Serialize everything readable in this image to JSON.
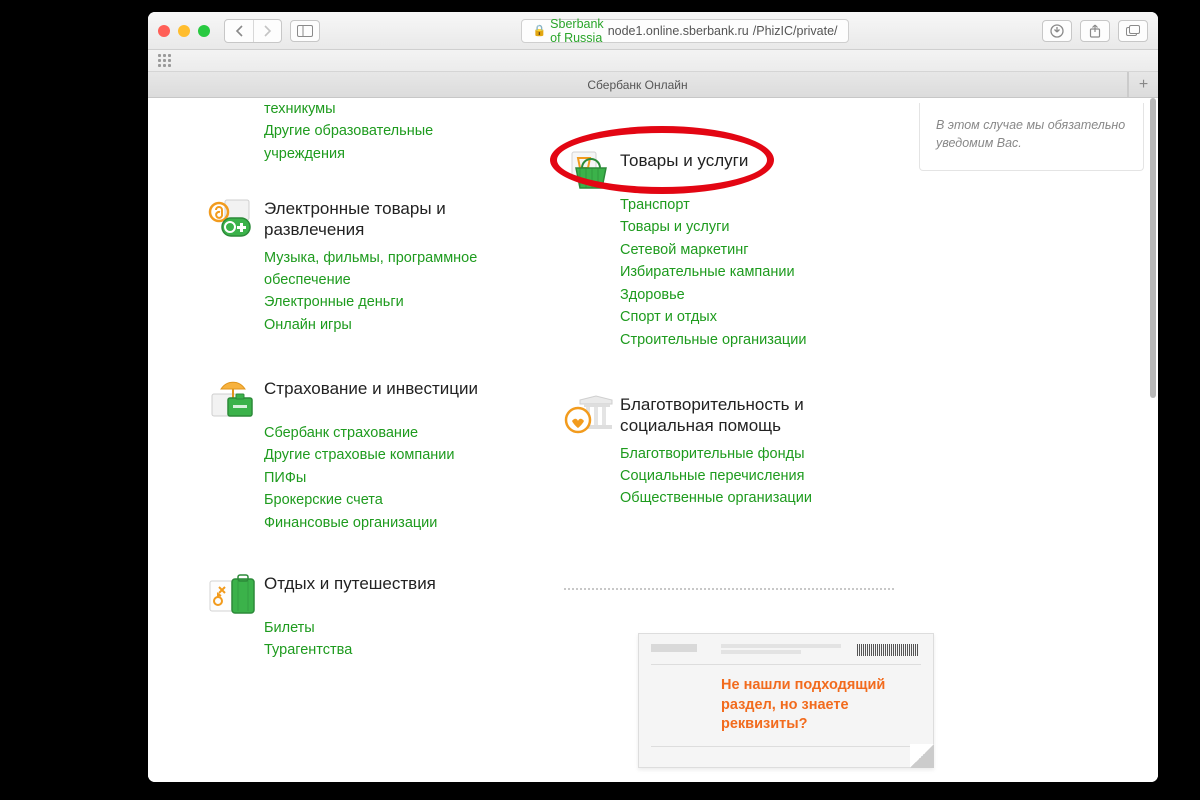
{
  "browser": {
    "secure_label": "Sberbank of Russia",
    "url_host": "node1.online.sberbank.ru",
    "url_path": "/PhizIC/private/",
    "tab_title": "Сбербанк Онлайн"
  },
  "sidebar_notice": "В этом случае мы обязательно уведомим Вас.",
  "top_orphan_links": [
    "техникумы",
    "Другие образовательные учреждения"
  ],
  "categories_left": [
    {
      "icon": "entertainment",
      "title": "Электронные товары и развлечения",
      "links": [
        "Музыка, фильмы, программное обеспечение",
        "Электронные деньги",
        "Онлайн игры"
      ]
    },
    {
      "icon": "insurance",
      "title": "Страхование и инвестиции",
      "links": [
        "Сбербанк страхование",
        "Другие страховые компании",
        "ПИФы",
        "Брокерские счета",
        "Финансовые организации"
      ]
    },
    {
      "icon": "travel",
      "title": "Отдых и путешествия",
      "links": [
        "Билеты",
        "Турагентства"
      ]
    }
  ],
  "categories_right": [
    {
      "icon": "goods",
      "title": "Товары и услуги",
      "links": [
        "Транспорт",
        "Товары и услуги",
        "Сетевой маркетинг",
        "Избирательные кампании",
        "Здоровье",
        "Спорт и отдых",
        "Строительные организации"
      ]
    },
    {
      "icon": "charity",
      "title": "Благотворительность и социальная помощь",
      "links": [
        "Благотворительные фонды",
        "Социальные перечисления",
        "Общественные организации"
      ]
    }
  ],
  "promo_text": "Не нашли подходящий раздел, но знаете реквизиты?"
}
